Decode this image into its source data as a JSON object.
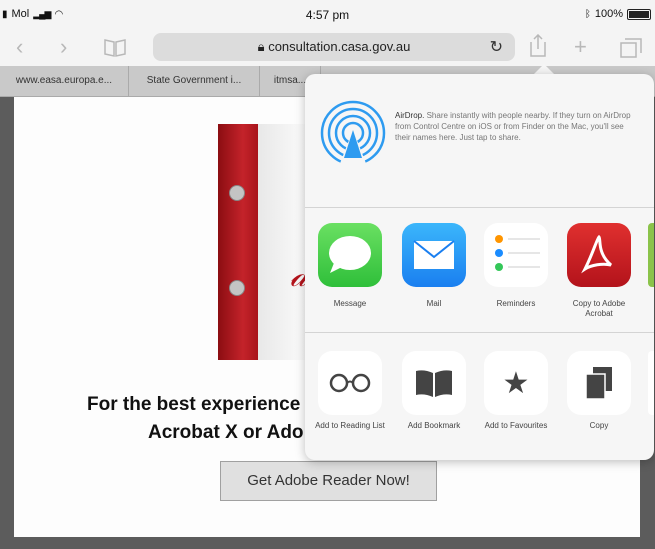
{
  "status": {
    "carrier": "Mol",
    "time": "4:57 pm",
    "battery": "100%"
  },
  "toolbar": {
    "url": "consultation.casa.gov.au"
  },
  "tabs": [
    {
      "label": "www.easa.europa.e..."
    },
    {
      "label": "State Government i..."
    },
    {
      "label": "itmsa..."
    }
  ],
  "page": {
    "heading_line1": "For the best experience",
    "heading_line2": "Acrobat X or Ado",
    "button": "Get Adobe Reader Now!"
  },
  "share_sheet": {
    "airdrop_title": "AirDrop.",
    "airdrop_text": "Share instantly with people nearby. If they turn on AirDrop from Control Centre on iOS or from Finder on the Mac, you'll see their names here. Just tap to share.",
    "apps": [
      {
        "label": "Message",
        "icon": "message-icon"
      },
      {
        "label": "Mail",
        "icon": "mail-icon"
      },
      {
        "label": "Reminders",
        "icon": "reminders-icon"
      },
      {
        "label": "Copy to Adobe Acrobat",
        "icon": "acrobat-icon"
      }
    ],
    "actions": [
      {
        "label": "Add to Reading List",
        "icon": "glasses-icon"
      },
      {
        "label": "Add Bookmark",
        "icon": "book-icon"
      },
      {
        "label": "Add to Favourites",
        "icon": "star-icon"
      },
      {
        "label": "Copy",
        "icon": "copy-icon"
      }
    ]
  },
  "colors": {
    "accent": "#1a8cff",
    "acrobat_red": "#c4232a",
    "message_green": "#34c759"
  }
}
